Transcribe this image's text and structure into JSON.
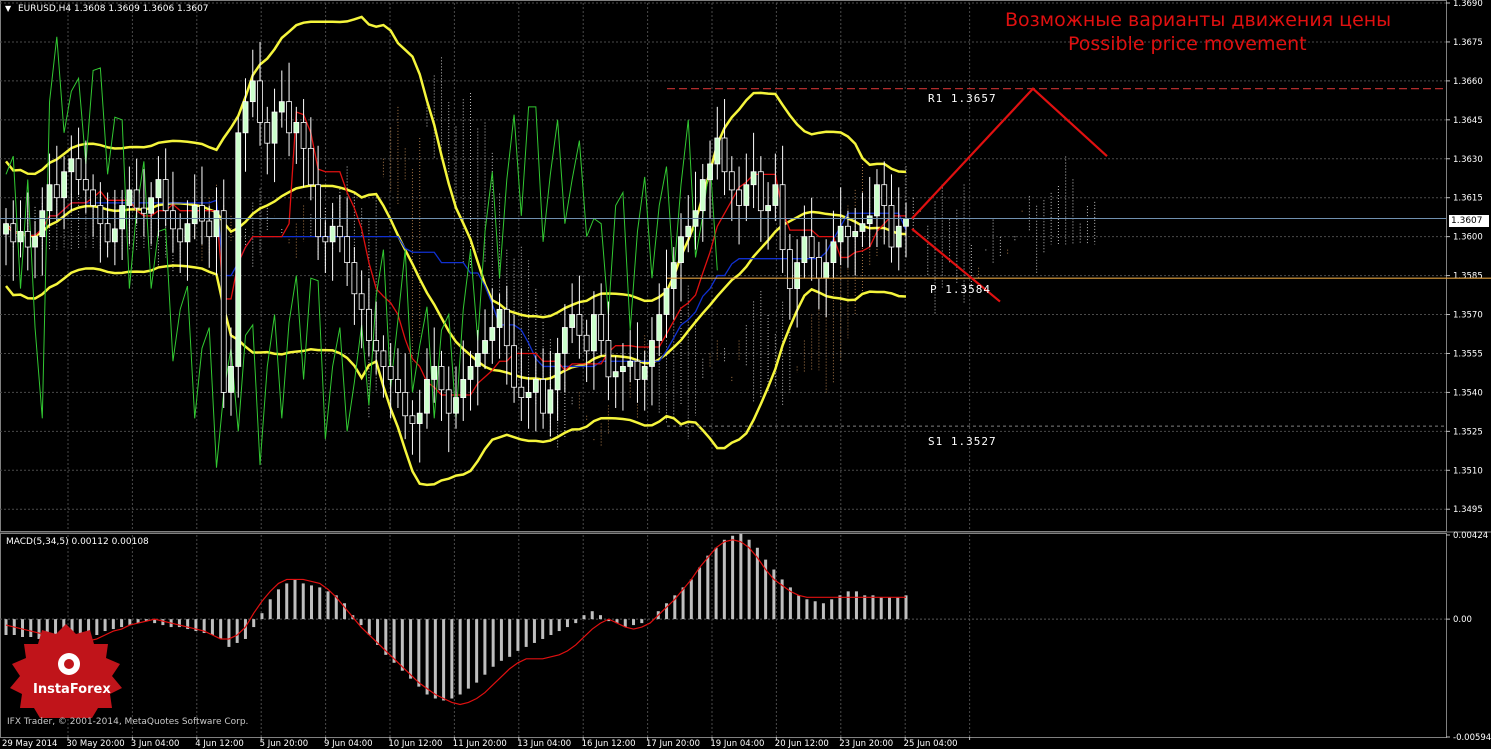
{
  "symbol_header": {
    "text": "EURUSD,H4  1.3608 1.3609 1.3606 1.3607",
    "arrow_icon": "triangle-down-icon"
  },
  "annotation": {
    "ru": "Возможные варианты движения цены",
    "en": "Possible price movement"
  },
  "levels": {
    "r1": "R1  1.3657",
    "p": "P  1.3584",
    "s1": "S1  1.3527"
  },
  "current_price_label": "1.3607",
  "macd_header": "MACD(5,34,5) 0.00112 0.00108",
  "logo_text": "InstaForex",
  "copyright": "IFX Trader, © 2001-2014, MetaQuotes Software Corp.",
  "colors": {
    "background": "#000000",
    "grid": "#4a4a4a",
    "bollinger": "#f5f53c",
    "candle_up": "#ffffff",
    "candle_body_up": "#ccffcc",
    "kijun": "#1030d0",
    "tenkan": "#e01010",
    "chikou": "#32c832",
    "cloud_a": "#ffffff",
    "cloud_b": "#e0a060",
    "projection": "#e01010",
    "r1_line": "#c83232",
    "pivot_line": "#e0a040",
    "macd_hist": "#bfbfbf",
    "macd_signal": "#e01010"
  },
  "chart_data": [
    {
      "type": "candlestick",
      "title": "EURUSD,H4",
      "y_ticks": [
        "1.3690",
        "1.3675",
        "1.3660",
        "1.3645",
        "1.3630",
        "1.3615",
        "1.3600",
        "1.3585",
        "1.3570",
        "1.3555",
        "1.3540",
        "1.3525",
        "1.3510",
        "1.3495"
      ],
      "ylim": [
        1.3487,
        1.369
      ],
      "x_ticks": [
        "29 May 2014",
        "30 May 20:00",
        "3 Jun 04:00",
        "4 Jun 12:00",
        "5 Jun 20:00",
        "9 Jun 04:00",
        "10 Jun 12:00",
        "11 Jun 20:00",
        "13 Jun 04:00",
        "16 Jun 12:00",
        "17 Jun 20:00",
        "19 Jun 04:00",
        "20 Jun 12:00",
        "23 Jun 20:00",
        "25 Jun 04:00"
      ],
      "last_price": 1.3607,
      "pivot_levels": {
        "R1": 1.3657,
        "P": 1.3584,
        "S1": 1.3527
      },
      "projection_paths": [
        {
          "name": "up",
          "points": [
            [
              1.3607
            ],
            [
              1.3657
            ],
            [
              1.3631
            ]
          ]
        },
        {
          "name": "down",
          "points": [
            [
              1.3603
            ],
            [
              1.3575
            ]
          ]
        }
      ],
      "closes": [
        1.3605,
        1.3598,
        1.3602,
        1.3596,
        1.36,
        1.361,
        1.362,
        1.3615,
        1.3625,
        1.363,
        1.3622,
        1.3618,
        1.3612,
        1.3605,
        1.3598,
        1.3603,
        1.3612,
        1.3618,
        1.3611,
        1.3609,
        1.3615,
        1.3622,
        1.361,
        1.3603,
        1.3598,
        1.3605,
        1.3612,
        1.3606,
        1.36,
        1.361,
        1.354,
        1.355,
        1.364,
        1.3652,
        1.366,
        1.3644,
        1.3636,
        1.3648,
        1.3652,
        1.364,
        1.3644,
        1.3634,
        1.362,
        1.36,
        1.3598,
        1.3604,
        1.36,
        1.359,
        1.3578,
        1.3572,
        1.356,
        1.3556,
        1.355,
        1.3545,
        1.354,
        1.3531,
        1.3528,
        1.3532,
        1.3545,
        1.355,
        1.3541,
        1.3532,
        1.3538,
        1.3545,
        1.355,
        1.3555,
        1.356,
        1.3565,
        1.3572,
        1.3558,
        1.3542,
        1.3538,
        1.354,
        1.3545,
        1.3532,
        1.3541,
        1.3555,
        1.3565,
        1.357,
        1.3562,
        1.3556,
        1.357,
        1.356,
        1.3546,
        1.3548,
        1.355,
        1.3552,
        1.3545,
        1.355,
        1.356,
        1.357,
        1.358,
        1.359,
        1.36,
        1.3604,
        1.361,
        1.3622,
        1.3628,
        1.3638,
        1.3625,
        1.3618,
        1.3612,
        1.362,
        1.3625,
        1.361,
        1.3612,
        1.362,
        1.3595,
        1.358,
        1.359,
        1.36,
        1.3592,
        1.3584,
        1.359,
        1.3598,
        1.3604,
        1.36,
        1.3602,
        1.3605,
        1.3608,
        1.362,
        1.3612,
        1.3596,
        1.3604,
        1.3607
      ],
      "macd": {
        "name": "MACD(5,34,5)",
        "y_ticks": [
          "0.00424",
          "0.00",
          "-0.00594"
        ],
        "ylim": [
          -0.00594,
          0.00424
        ],
        "main": [
          -0.0008,
          -0.0008,
          -0.0009,
          -0.0009,
          -0.001,
          -0.0011,
          -0.0012,
          -0.0011,
          -0.0009,
          -0.0008,
          -0.0007,
          -0.0008,
          -0.0006,
          -0.0005,
          -0.0004,
          -0.0003,
          -0.0002,
          -0.0001,
          -0.0002,
          -0.0003,
          -0.0004,
          -0.0004,
          -0.0005,
          -0.0006,
          -0.0007,
          -0.0008,
          -0.001,
          -0.0014,
          -0.0012,
          -0.001,
          -0.0004,
          0.0003,
          0.001,
          0.0015,
          0.0018,
          0.002,
          0.0018,
          0.0017,
          0.0016,
          0.0014,
          0.0012,
          0.0008,
          0.0002,
          -0.0003,
          -0.0008,
          -0.0013,
          -0.0018,
          -0.0022,
          -0.0026,
          -0.003,
          -0.0034,
          -0.0038,
          -0.004,
          -0.0041,
          -0.004,
          -0.0038,
          -0.0035,
          -0.0032,
          -0.0028,
          -0.0024,
          -0.0021,
          -0.0019,
          -0.0016,
          -0.0014,
          -0.0012,
          -0.001,
          -0.0008,
          -0.0006,
          -0.0004,
          -0.0002,
          0.0002,
          0.0004,
          0.0002,
          -0.0001,
          -0.0002,
          -0.0004,
          -0.0003,
          -0.0002,
          0.0,
          0.0004,
          0.0008,
          0.0012,
          0.0016,
          0.002,
          0.0026,
          0.0032,
          0.0036,
          0.004,
          0.0042,
          0.0043,
          0.004,
          0.0036,
          0.003,
          0.0025,
          0.002,
          0.0016,
          0.0012,
          0.001,
          0.0009,
          0.0008,
          0.001,
          0.0012,
          0.0014,
          0.0014,
          0.0012,
          0.0012,
          0.0011,
          0.0011,
          0.0011,
          0.0012
        ],
        "signal": [
          -0.0003,
          -0.0004,
          -0.0005,
          -0.0006,
          -0.0007,
          -0.0008,
          -0.0009,
          -0.001,
          -0.0011,
          -0.0011,
          -0.0011,
          -0.001,
          -0.0008,
          -0.0006,
          -0.0005,
          -0.0003,
          -0.0002,
          -0.0001,
          0.0,
          -0.0001,
          -0.0002,
          -0.0003,
          -0.0004,
          -0.0005,
          -0.0006,
          -0.0008,
          -0.001,
          -0.001,
          -0.0008,
          -0.0004,
          0.0003,
          0.0009,
          0.0014,
          0.0018,
          0.002,
          0.002,
          0.002,
          0.0019,
          0.0018,
          0.0015,
          0.0011,
          0.0006,
          0.0001,
          -0.0004,
          -0.0008,
          -0.0012,
          -0.0016,
          -0.002,
          -0.0024,
          -0.0028,
          -0.0032,
          -0.0035,
          -0.0038,
          -0.004,
          -0.0042,
          -0.0043,
          -0.0042,
          -0.004,
          -0.0037,
          -0.0033,
          -0.0029,
          -0.0025,
          -0.0022,
          -0.002,
          -0.002,
          -0.002,
          -0.0019,
          -0.0018,
          -0.0016,
          -0.0013,
          -0.0009,
          -0.0005,
          -0.0002,
          0.0,
          -0.0002,
          -0.0004,
          -0.0005,
          -0.0004,
          -0.0002,
          0.0002,
          0.0006,
          0.001,
          0.0015,
          0.002,
          0.0026,
          0.0031,
          0.0036,
          0.0039,
          0.004,
          0.0039,
          0.0036,
          0.0031,
          0.0025,
          0.002,
          0.0017,
          0.0014,
          0.0012,
          0.0011,
          0.0011,
          0.0011,
          0.0011,
          0.0011,
          0.0011,
          0.0011,
          0.0011,
          0.0011,
          0.0011,
          0.0011,
          0.0011,
          0.0011
        ]
      }
    }
  ]
}
